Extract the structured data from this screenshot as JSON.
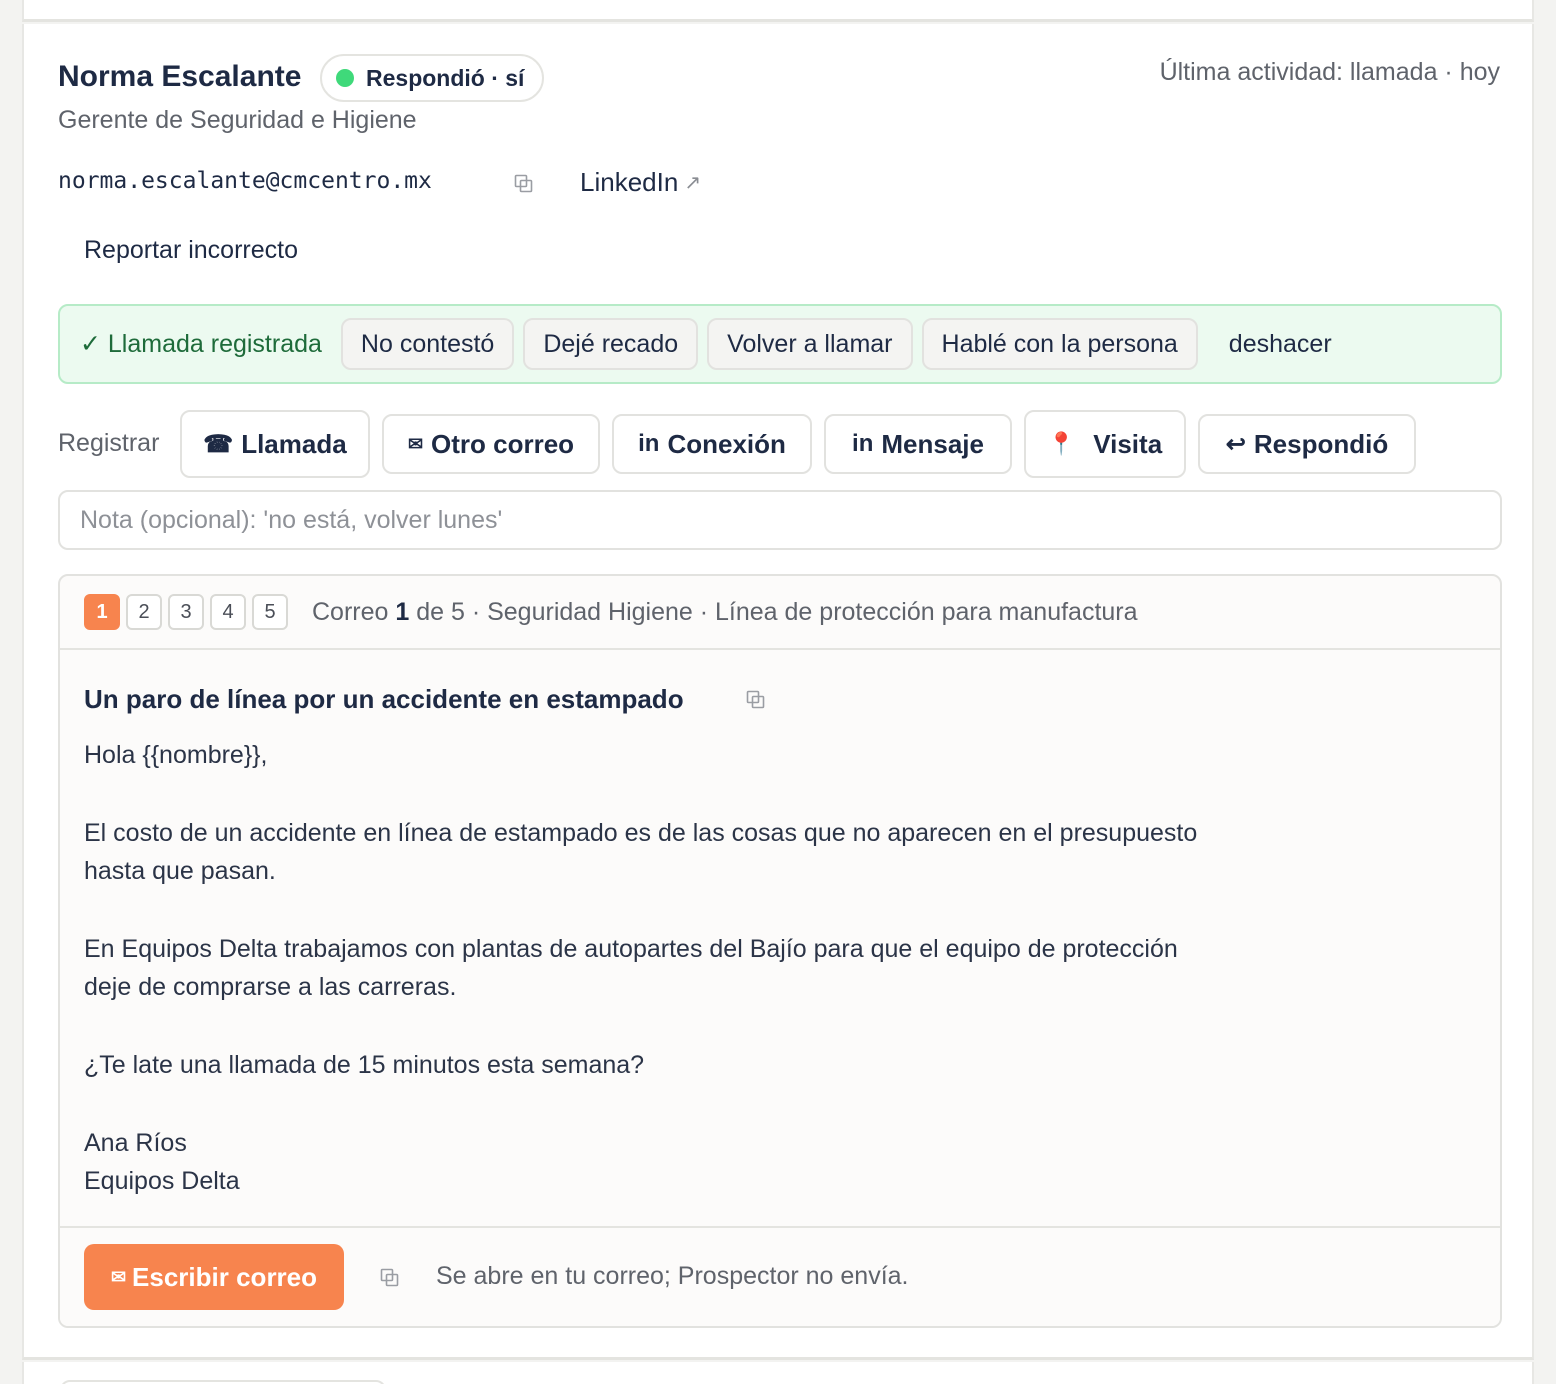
{
  "contact": {
    "name": "Norma Escalante",
    "status": "Respondió · sí",
    "role": "Gerente de Seguridad e Higiene",
    "email": "norma.escalante@cmcentro.mx",
    "linkedin_label": "LinkedIn",
    "last_activity": "Última actividad: llamada · hoy",
    "report_label": "Reportar incorrecto"
  },
  "call_log": {
    "status": "✓ Llamada registrada",
    "outcomes": [
      "No contestó",
      "Dejé recado",
      "Volver a llamar",
      "Hablé con la persona"
    ],
    "undo_label": "deshacer"
  },
  "register": {
    "label": "Registrar",
    "actions": [
      {
        "icon": "☎",
        "icon_name": "phone-icon",
        "label": "Llamada"
      },
      {
        "icon": "✉",
        "icon_name": "mail-icon",
        "label": "Otro correo"
      },
      {
        "icon": "in",
        "icon_name": "linkedin-icon",
        "label": "Conexión"
      },
      {
        "icon": "in",
        "icon_name": "linkedin-icon",
        "label": "Mensaje"
      },
      {
        "icon": "📍",
        "icon_name": "pin-icon",
        "label": "Visita"
      },
      {
        "icon": "↩",
        "icon_name": "reply-icon",
        "label": "Respondió"
      }
    ]
  },
  "note": {
    "placeholder": "Nota (opcional): 'no está, volver lunes'"
  },
  "sequence": {
    "steps": [
      "1",
      "2",
      "3",
      "4",
      "5"
    ],
    "active_step": 1,
    "info_prefix": "Correo",
    "info_current": "1",
    "info_suffix": "de 5 · Seguridad Higiene · Línea de protección para manufactura"
  },
  "email_draft": {
    "subject": "Un paro de línea por un accidente en estampado",
    "greeting": "Hola {{nombre}},",
    "paragraph1": "El costo de un accidente en línea de estampado es de las cosas que no aparecen en el presupuesto hasta que pasan.",
    "paragraph2": "En Equipos Delta trabajamos con plantas de autopartes del Bajío para que el equipo de protección deje de comprarse a las carreras.",
    "question": "¿Te late una llamada de 15 minutos esta semana?",
    "signature_name": "Ana Ríos",
    "signature_company": "Equipos Delta"
  },
  "footer": {
    "compose_icon": "✉",
    "compose_label": "Escribir correo",
    "note": "Se abre en tu correo; Prospector no envía."
  },
  "colors": {
    "accent": "#f7844e",
    "success_bg": "#ecfaf0",
    "success_border": "#b6ebc7",
    "status_dot": "#3fd97a"
  }
}
